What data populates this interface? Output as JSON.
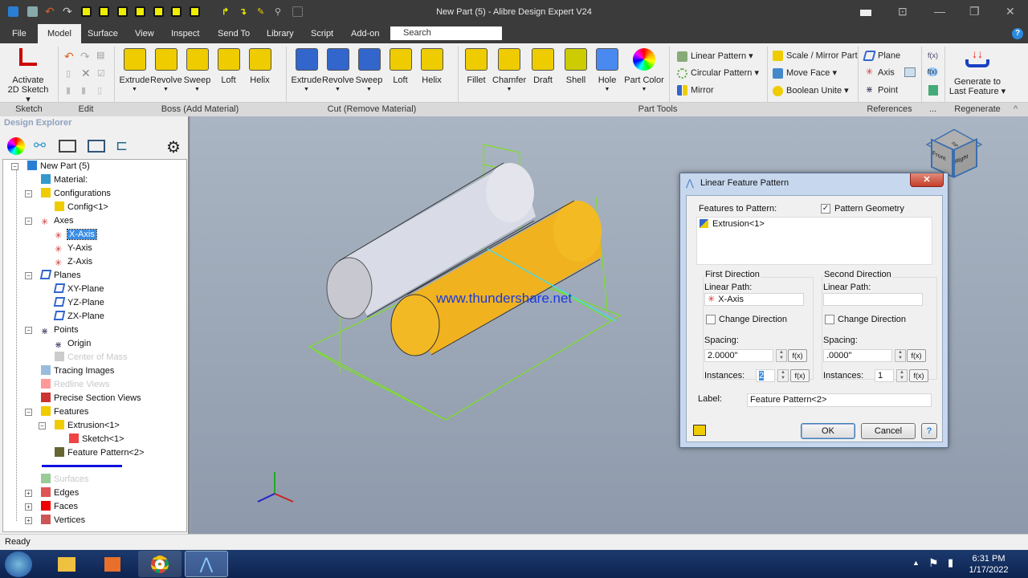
{
  "window": {
    "title": "New Part (5) - Alibre Design Expert V24"
  },
  "menu": {
    "tabs": [
      "File",
      "Model",
      "Surface",
      "View",
      "Inspect",
      "Send To",
      "Library",
      "Script",
      "Add-on"
    ],
    "active": "Model",
    "search_placeholder": "Search"
  },
  "ribbon": {
    "sketch": {
      "label": "Activate 2D Sketch",
      "line1": "Activate",
      "line2": "2D Sketch ▾"
    },
    "boss": [
      "Extrude",
      "Revolve",
      "Sweep",
      "Loft",
      "Helix"
    ],
    "cut": [
      "Extrude",
      "Revolve",
      "Sweep",
      "Loft",
      "Helix"
    ],
    "part_tools": [
      "Fillet",
      "Chamfer",
      "Draft",
      "Shell",
      "Hole",
      "Part Color"
    ],
    "patterns": [
      "Linear Pattern ▾",
      "Circular Pattern ▾",
      "Mirror"
    ],
    "modify": [
      "Scale / Mirror Part",
      "Move Face ▾",
      "Boolean Unite ▾"
    ],
    "references": [
      "Plane",
      "Axis",
      "Point"
    ],
    "regenerate": {
      "line1": "Generate to",
      "line2": "Last Feature ▾"
    },
    "groups": [
      "Sketch",
      "Edit",
      "Boss (Add Material)",
      "Cut (Remove Material)",
      "Part Tools",
      "References",
      "...",
      "Regenerate"
    ]
  },
  "explorer": {
    "title": "Design Explorer",
    "tree": [
      {
        "label": "New Part (5)"
      },
      {
        "label": "Material:"
      },
      {
        "label": "Configurations"
      },
      {
        "label": "Config<1>"
      },
      {
        "label": "Axes"
      },
      {
        "label": "X-Axis"
      },
      {
        "label": "Y-Axis"
      },
      {
        "label": "Z-Axis"
      },
      {
        "label": "Planes"
      },
      {
        "label": "XY-Plane"
      },
      {
        "label": "YZ-Plane"
      },
      {
        "label": "ZX-Plane"
      },
      {
        "label": "Points"
      },
      {
        "label": "Origin"
      },
      {
        "label": "Center of Mass"
      },
      {
        "label": "Tracing Images"
      },
      {
        "label": "Redline Views"
      },
      {
        "label": "Precise Section Views"
      },
      {
        "label": "Features"
      },
      {
        "label": "Extrusion<1>"
      },
      {
        "label": "Sketch<1>"
      },
      {
        "label": "Feature Pattern<2>"
      },
      {
        "label": "Surfaces"
      },
      {
        "label": "Edges"
      },
      {
        "label": "Faces"
      },
      {
        "label": "Vertices"
      }
    ],
    "selected": "X-Axis"
  },
  "viewport": {
    "watermark": "www.thundershare.net",
    "cube": [
      "Top",
      "Front",
      "Right"
    ]
  },
  "dialog": {
    "title": "Linear Feature Pattern",
    "features_label": "Features to Pattern:",
    "pattern_geometry_label": "Pattern Geometry",
    "pattern_geometry": true,
    "features": [
      "Extrusion<1>"
    ],
    "first": {
      "title": "First Direction",
      "path_label": "Linear Path:",
      "path": "X-Axis",
      "change_label": "Change Direction",
      "change": false,
      "spacing_label": "Spacing:",
      "spacing": "2.0000\"",
      "instances_label": "Instances:",
      "instances": "2"
    },
    "second": {
      "title": "Second Direction",
      "path_label": "Linear Path:",
      "path": "",
      "change_label": "Change Direction",
      "change": false,
      "spacing_label": "Spacing:",
      "spacing": ".0000\"",
      "instances_label": "Instances:",
      "instances": "1"
    },
    "fx": "f(x)",
    "label_label": "Label:",
    "label_value": "Feature Pattern<2>",
    "ok": "OK",
    "cancel": "Cancel",
    "help": "?"
  },
  "status": {
    "text": "Ready"
  },
  "taskbar": {
    "time": "6:31 PM",
    "date": "1/17/2022"
  }
}
